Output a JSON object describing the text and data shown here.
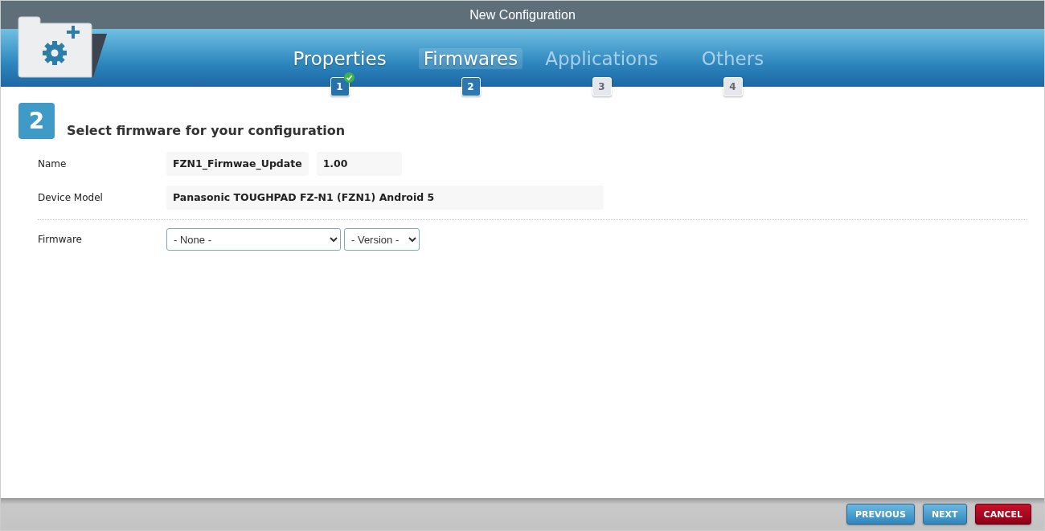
{
  "window": {
    "title": "New Configuration"
  },
  "steps": [
    {
      "label": "Properties",
      "number": "1",
      "completed": true,
      "selected": false,
      "disabled": false
    },
    {
      "label": "Firmwares",
      "number": "2",
      "completed": false,
      "selected": true,
      "disabled": false
    },
    {
      "label": "Applications",
      "number": "3",
      "completed": false,
      "selected": false,
      "disabled": true
    },
    {
      "label": "Others",
      "number": "4",
      "completed": false,
      "selected": false,
      "disabled": true
    }
  ],
  "section": {
    "number": "2",
    "heading": "Select firmware for your configuration"
  },
  "form": {
    "name": {
      "label": "Name",
      "value": "FZN1_Firmwae_Update",
      "version": "1.00"
    },
    "device_model": {
      "label": "Device Model",
      "value": "Panasonic TOUGHPAD FZ-N1 (FZN1) Android 5"
    },
    "firmware": {
      "label": "Firmware",
      "firmware_select": "- None -",
      "version_select": "- Version -"
    }
  },
  "buttons": [
    {
      "label": "PREVIOUS",
      "kind": "secondary"
    },
    {
      "label": "NEXT",
      "kind": "secondary"
    },
    {
      "label": "CANCEL",
      "kind": "danger"
    }
  ]
}
